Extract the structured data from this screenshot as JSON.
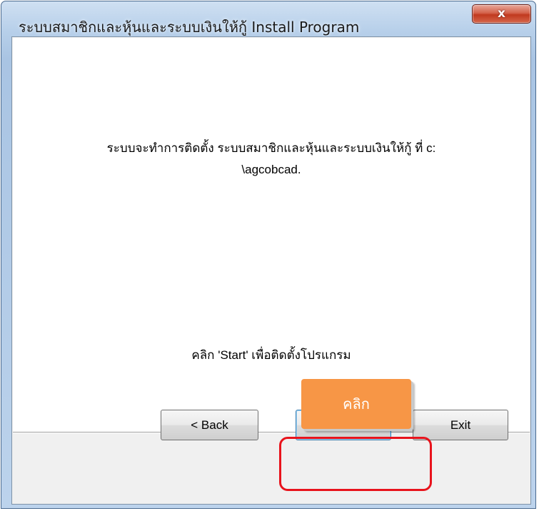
{
  "window": {
    "title": "ระบบสมาชิกและหุ้นและระบบเงินให้กู้ Install Program",
    "close_label": "x"
  },
  "content": {
    "message_line1": "ระบบจะทำการติดตั้ง ระบบสมาชิกและหุ้นและระบบเงินให้กู้ ที่ c:",
    "message_line2": "\\agcobcad.",
    "hint": "คลิก 'Start' เพื่อติดตั้งโปรแกรม"
  },
  "buttons": {
    "back_label": "< Back",
    "start_label": "Start",
    "exit_label": "Exit"
  },
  "annotation": {
    "callout_label": "คลิก",
    "callout_color": "#f79646",
    "highlight_color": "#e8131c"
  }
}
